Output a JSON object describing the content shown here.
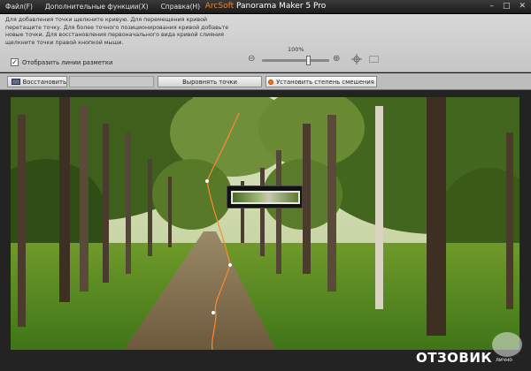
{
  "menu": {
    "items": [
      {
        "label": "Файл(F)"
      },
      {
        "label": "Дополнительные функции(X)"
      },
      {
        "label": "Справка(H)"
      }
    ]
  },
  "title": {
    "brand": "ArcSoft",
    "product": "Panorama Maker 5 Pro"
  },
  "window_buttons": {
    "minimize": "–",
    "maximize": "□",
    "close": "✕"
  },
  "instructions": {
    "text": "Для добавления точки щелкните кривую. Для перемещения кривой перетащите точку. Для более точного позиционирования кривой добавьте новые точки. Для восстановления первоначального вида кривой слияния щелкните точки правой кнопкой мыши."
  },
  "show_grid": {
    "label": "Отобразить линии разметки",
    "checked": true,
    "check_glyph": "✓"
  },
  "zoom": {
    "level": "100%",
    "slider_fraction": 0.7,
    "zoom_out_glyph": "⊖",
    "zoom_in_glyph": "⊕"
  },
  "toolbar": {
    "restore_label": "Восстановить",
    "align_label": "Выровнять точки",
    "blend_label": "Установить степень смешения"
  },
  "colors": {
    "accent": "#ee7a17",
    "seam": "#ff8a2a"
  },
  "watermark": {
    "text": "ОТЗОВИК",
    "sub": "лично"
  }
}
